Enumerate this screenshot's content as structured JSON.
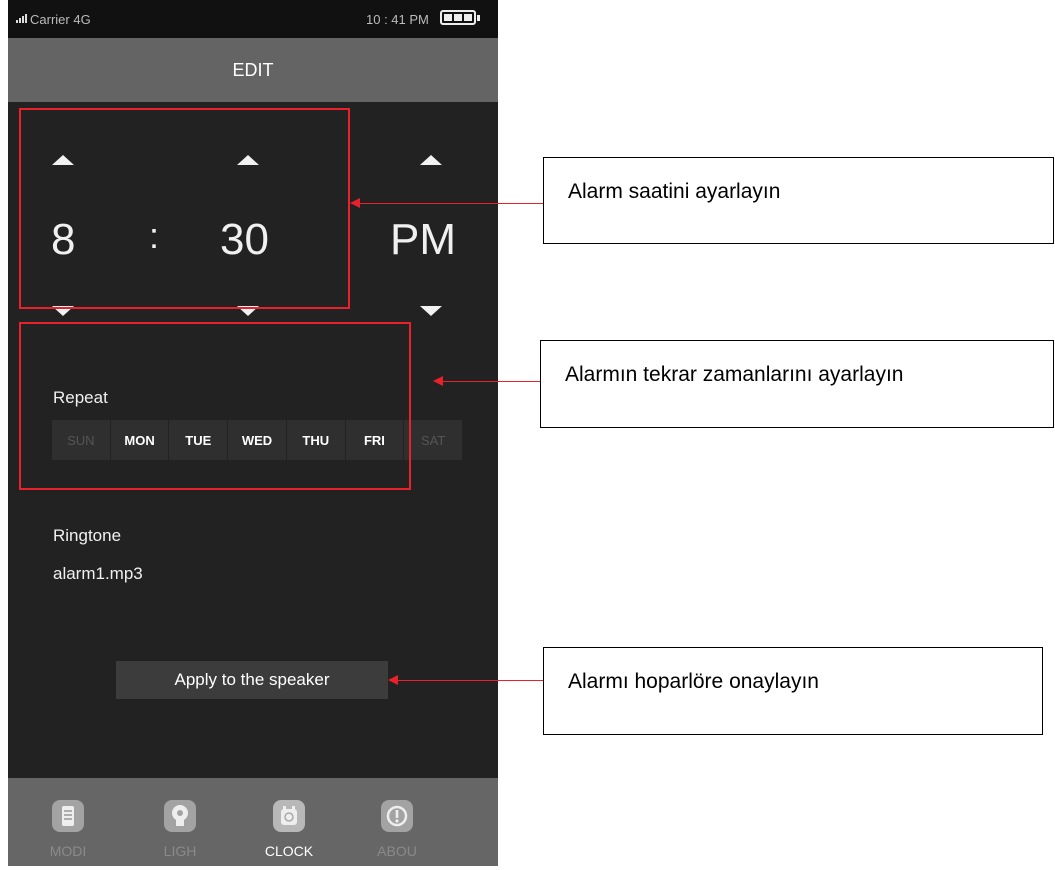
{
  "status_bar": {
    "carrier": "Carrier 4G",
    "time": "10 : 41 PM"
  },
  "header": {
    "title": "EDIT"
  },
  "time_picker": {
    "hour": "8",
    "separator": ":",
    "minute": "30",
    "period": "PM"
  },
  "repeat": {
    "label": "Repeat",
    "days": [
      {
        "label": "SUN",
        "selected": false
      },
      {
        "label": "MON",
        "selected": true
      },
      {
        "label": "TUE",
        "selected": true
      },
      {
        "label": "WED",
        "selected": true
      },
      {
        "label": "THU",
        "selected": true
      },
      {
        "label": "FRI",
        "selected": true
      },
      {
        "label": "SAT",
        "selected": false
      }
    ]
  },
  "ringtone": {
    "label": "Ringtone",
    "value": "alarm1.mp3"
  },
  "apply_button": {
    "label": "Apply to the speaker"
  },
  "tabs": [
    {
      "label": "MODI",
      "icon": "list-icon",
      "active": false
    },
    {
      "label": "LIGH",
      "icon": "bulb-icon",
      "active": false
    },
    {
      "label": "CLOCK",
      "icon": "clock-icon",
      "active": true
    },
    {
      "label": "ABOU",
      "icon": "info-icon",
      "active": false
    }
  ],
  "callouts": {
    "time": "Alarm saatini ayarlayın",
    "repeat": "Alarmın tekrar zamanlarını ayarlayın",
    "apply": "Alarmı hoparlöre onaylayın"
  },
  "colors": {
    "annotation_red": "#e8212a",
    "title_bar": "#646464",
    "background": "#222222"
  }
}
